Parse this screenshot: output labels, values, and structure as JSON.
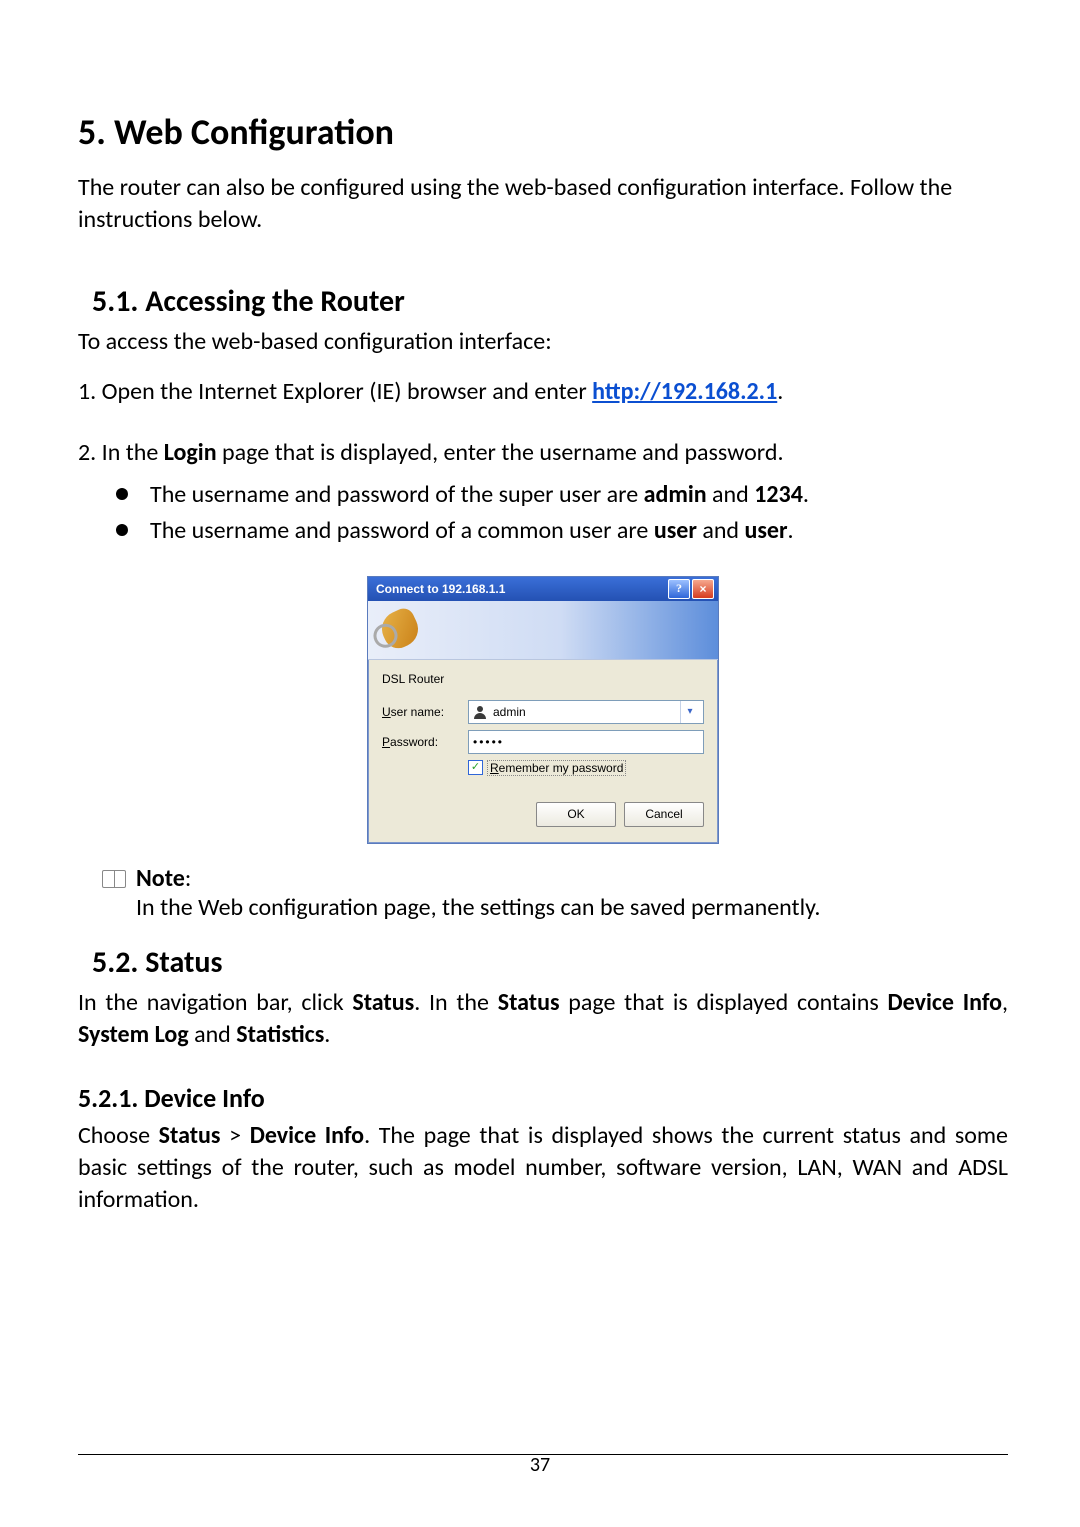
{
  "h1": "5. Web Configuration",
  "intro": "The router can also be configured using the web-based configuration interface. Follow the instructions below.",
  "s51": {
    "heading": "5.1.  Accessing the Router",
    "lead": "To access the web-based configuration interface:",
    "step1_pre": "1. Open the Internet Explorer (IE) browser and enter ",
    "step1_url": "http://192.168.2.1",
    "step1_post": ".",
    "step2_pre": "2. In the ",
    "step2_b": "Login",
    "step2_post": " page that is displayed, enter the username and password.",
    "bul1_pre": "The username and password of the super user are ",
    "bul1_b1": "admin",
    "bul1_mid": " and ",
    "bul1_b2": "1234",
    "bul1_post": ".",
    "bul2_pre": "The username and password of a common user are ",
    "bul2_b1": "user",
    "bul2_mid": " and ",
    "bul2_b2": "user",
    "bul2_post": "."
  },
  "dialog": {
    "title": "Connect to 192.168.1.1",
    "header": "DSL Router",
    "user_label": "User name:",
    "user_u": "U",
    "user_rest": "ser name:",
    "pass_u": "P",
    "pass_rest": "assword:",
    "user_value": "admin",
    "pass_value": "•••••",
    "remember_u": "R",
    "remember_rest": "emember my password",
    "ok": "OK",
    "cancel": "Cancel"
  },
  "note": {
    "label": "Note",
    "text": "In the Web configuration page, the settings can be saved permanently."
  },
  "s52": {
    "heading": "5.2.  Status",
    "pre": "In the navigation bar, click ",
    "b1": "Status",
    "mid1": ". In the ",
    "b2": "Status",
    "mid2": " page that is displayed contains ",
    "b3": "Device Info",
    "mid3": ", ",
    "b4": "System Log",
    "mid4": " and ",
    "b5": "Statistics",
    "post": "."
  },
  "s521": {
    "heading": "5.2.1.   Device Info",
    "pre": "Choose ",
    "b1": "Status",
    "mid1": " > ",
    "b2": "Device Info",
    "post": ". The page that is displayed shows the current status and some basic settings of the router, such as model number, software version, LAN, WAN and ADSL information."
  },
  "page_number": "37"
}
